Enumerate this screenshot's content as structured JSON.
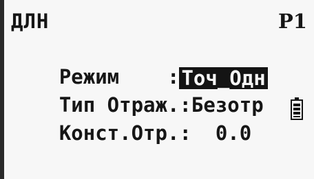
{
  "header": {
    "title": "ДЛН",
    "page": "P1"
  },
  "settings": [
    {
      "label": "Режим",
      "separator": ":",
      "value": "Точ_Одн",
      "selected": true
    },
    {
      "label": "Тип Отраж.",
      "separator": ":",
      "value": "Безотр",
      "selected": false
    },
    {
      "label": "Конст.Отр.",
      "separator": ":",
      "value": "0.0",
      "selected": false
    }
  ],
  "status": {
    "battery_icon": "battery-icon"
  }
}
